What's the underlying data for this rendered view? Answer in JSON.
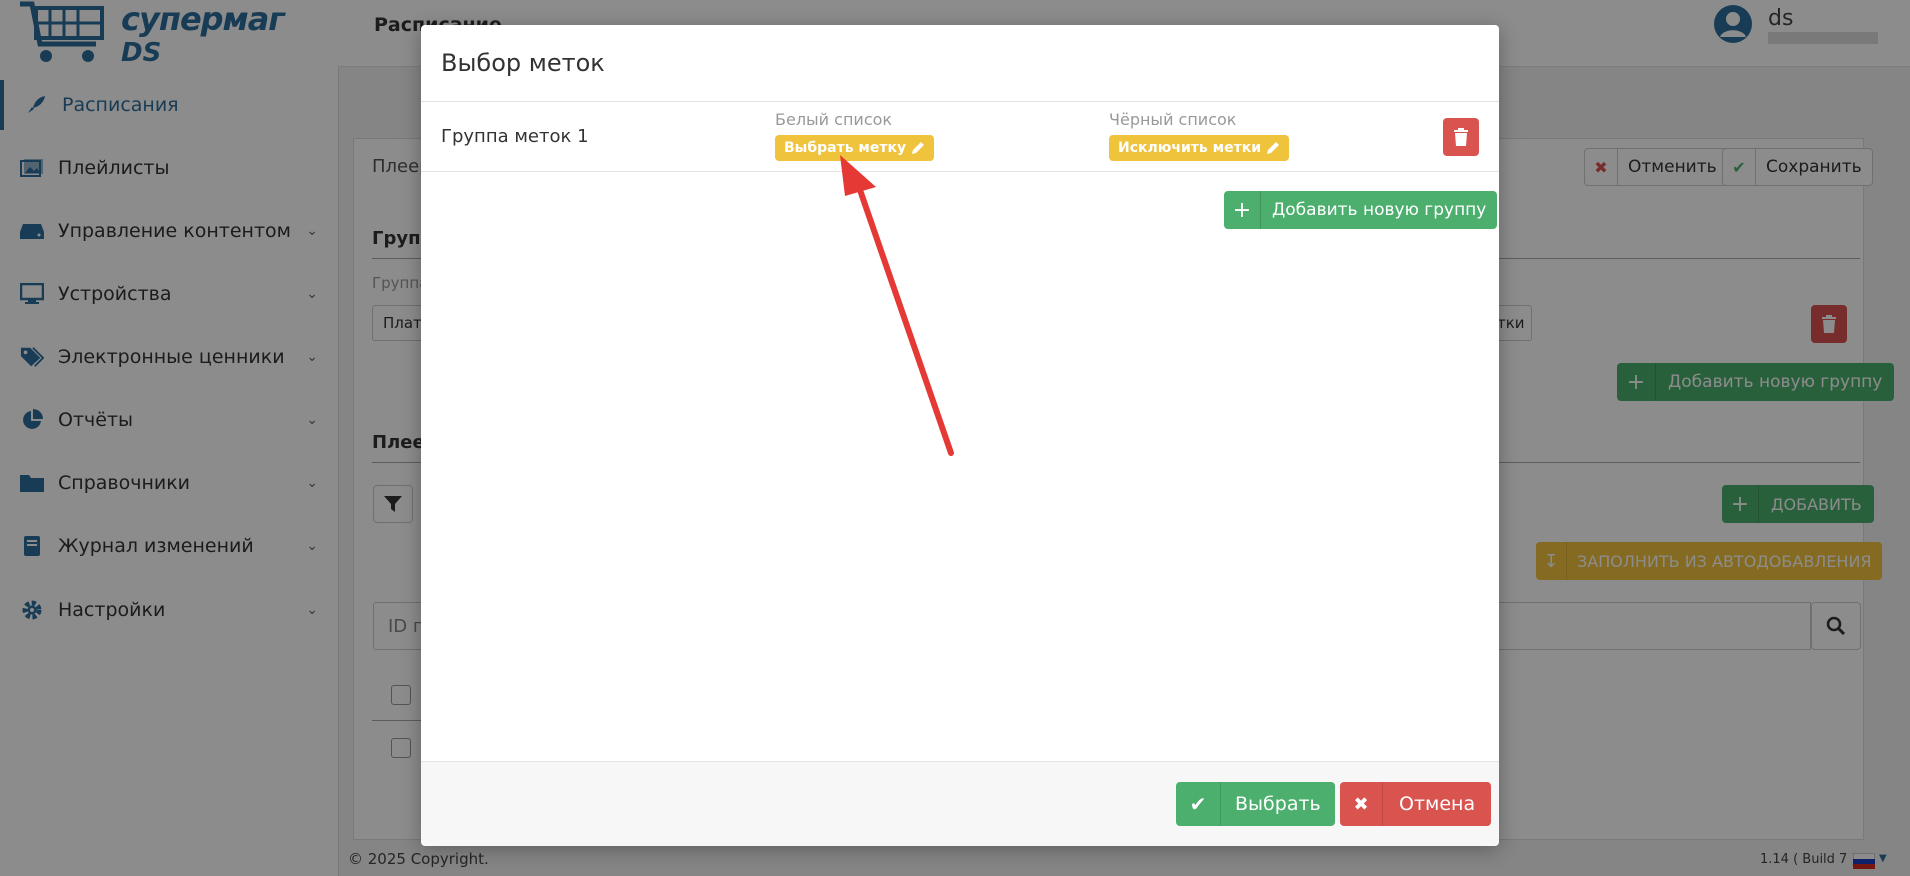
{
  "app": {
    "logo_line1": "супермаг",
    "logo_line2": "DS"
  },
  "sidebar": {
    "items": [
      {
        "label": "Расписания",
        "icon": "rocket-icon",
        "active": true
      },
      {
        "label": "Плейлисты",
        "icon": "images-icon"
      },
      {
        "label": "Управление контентом",
        "icon": "hdd-icon"
      },
      {
        "label": "Устройства",
        "icon": "desktop-icon"
      },
      {
        "label": "Электронные ценники",
        "icon": "tags-icon"
      },
      {
        "label": "Отчёты",
        "icon": "pie-chart-icon"
      },
      {
        "label": "Справочники",
        "icon": "folder-icon"
      },
      {
        "label": "Журнал изменений",
        "icon": "book-icon"
      },
      {
        "label": "Настройки",
        "icon": "gear-icon"
      }
    ]
  },
  "header": {
    "title": "Расписание",
    "user_name": "ds"
  },
  "background": {
    "tab_label": "Плеер",
    "cancel_label": "Отменить",
    "save_label": "Сохранить",
    "group_heading": "Групп",
    "group_field_label": "Группа",
    "platform_value": "Плат",
    "tags_value": "тки",
    "add_group_label": "Добавить новую группу",
    "players_heading": "Плее",
    "add_label": "ДОБАВИТЬ",
    "autofill_label": "ЗАПОЛНИТЬ ИЗ АВТОДОБАВЛЕНИЯ",
    "search_placeholder": "ID п"
  },
  "modal": {
    "title": "Выбор меток",
    "group_name": "Группа меток 1",
    "whitelist_label": "Белый список",
    "whitelist_button": "Выбрать метку",
    "blacklist_label": "Чёрный список",
    "blacklist_button": "Исключить метки",
    "add_group_label": "Добавить новую группу",
    "select_label": "Выбрать",
    "cancel_label": "Отмена"
  },
  "footer": {
    "copyright": "© 2025 Copyright.",
    "version": "1.14 ( Build 7 )"
  },
  "colors": {
    "primary": "#2d6e9c",
    "success": "#4caf6e",
    "danger": "#d9534f",
    "warning": "#f0c33c",
    "annotation_arrow": "#e53935"
  }
}
